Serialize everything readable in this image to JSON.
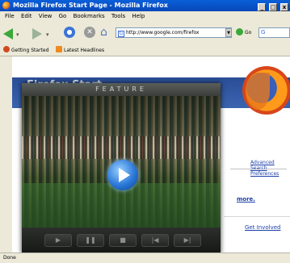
{
  "window": {
    "title": "Mozilla Firefox Start Page - Mozilla Firefox",
    "min": "_",
    "max": "□",
    "close": "x"
  },
  "menu": [
    "File",
    "Edit",
    "View",
    "Go",
    "Bookmarks",
    "Tools",
    "Help"
  ],
  "nav": {
    "url": "http://www.google.com/firefox",
    "go_label": "Go",
    "search_value": "G"
  },
  "bookmarks": [
    "Getting Started",
    "Latest Headlines"
  ],
  "page": {
    "banner_title": "Firefox Start",
    "links": [
      "Advanced Search",
      "Preferences"
    ],
    "more": "more.",
    "get_involved": "Get Involved"
  },
  "player": {
    "title": "FEATURE",
    "controls": [
      "▶",
      "❚❚",
      "■",
      "|◀",
      "▶|"
    ]
  },
  "status": "Done"
}
